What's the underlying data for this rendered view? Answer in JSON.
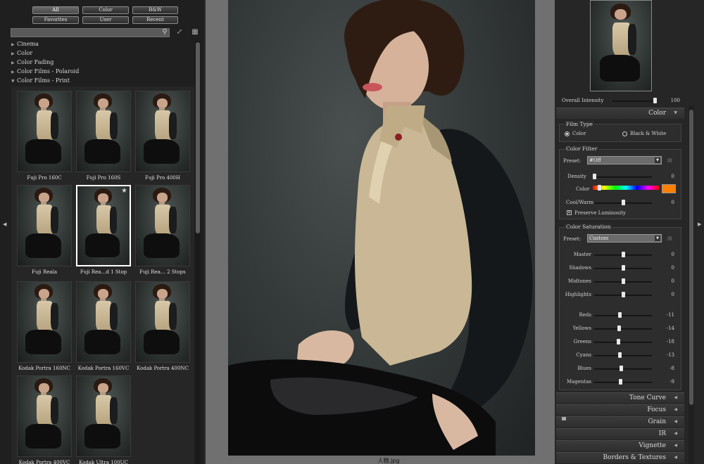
{
  "filter_buttons": [
    {
      "label": "All"
    },
    {
      "label": "Color"
    },
    {
      "label": "B&W"
    },
    {
      "label": "Favorites"
    },
    {
      "label": "User"
    },
    {
      "label": "Recent"
    }
  ],
  "search": {
    "placeholder": ""
  },
  "categories": [
    {
      "label": "Cinema"
    },
    {
      "label": "Color"
    },
    {
      "label": "Color Fading"
    },
    {
      "label": "Color Films - Polaroid"
    },
    {
      "label": "Color Films - Print"
    }
  ],
  "presets": [
    {
      "label": "Fuji Pro 160C"
    },
    {
      "label": "Fuji Pro 160S"
    },
    {
      "label": "Fuji Pro 400H"
    },
    {
      "label": "Fuji Reala"
    },
    {
      "label": "Fuji Rea…d 1 Stop"
    },
    {
      "label": "Fuji Rea… 2 Stops"
    },
    {
      "label": "Kodak Portra 160NC"
    },
    {
      "label": "Kodak Portra 160VC"
    },
    {
      "label": "Kodak Portra 400NC"
    },
    {
      "label": "Kodak Portra 400VC"
    },
    {
      "label": "Kodak Ultra 100UC"
    }
  ],
  "selected_preset_index": 4,
  "favorite_star": "★",
  "filename": "人物.jpg",
  "right": {
    "overall_intensity": {
      "label": "Overall Intensity",
      "value": "100",
      "level": 1.0
    },
    "color_section": {
      "title": "Color"
    },
    "film_type": {
      "title": "Film Type",
      "color_label": "Color",
      "bw_label": "Black & White",
      "selected": "Color"
    },
    "color_filter": {
      "title": "Color Filter",
      "preset_label": "Preset:",
      "preset_value": "#Off",
      "density": {
        "label": "Density",
        "value": "0",
        "level": 0.0
      },
      "color": {
        "label": "Color",
        "swatch": "#ff8000",
        "level": 0.1
      },
      "cool_warm": {
        "label": "Cool/Warm",
        "value": "0",
        "level": 0.5
      },
      "preserve_luminosity": {
        "label": "Preserve Luminosity",
        "checked": true
      }
    },
    "color_saturation": {
      "title": "Color Saturation",
      "preset_label": "Preset:",
      "preset_value": "Custom",
      "sliders": [
        {
          "label": "Master",
          "value": "0",
          "level": 0.5
        },
        {
          "label": "Shadows",
          "value": "0",
          "level": 0.5
        },
        {
          "label": "Midtones",
          "value": "0",
          "level": 0.5
        },
        {
          "label": "Highlights",
          "value": "0",
          "level": 0.5
        }
      ],
      "color_sliders": [
        {
          "label": "Reds",
          "value": "-11",
          "level": 0.445
        },
        {
          "label": "Yellows",
          "value": "-14",
          "level": 0.43
        },
        {
          "label": "Greens",
          "value": "-18",
          "level": 0.41
        },
        {
          "label": "Cyans",
          "value": "-13",
          "level": 0.435
        },
        {
          "label": "Blues",
          "value": "-8",
          "level": 0.46
        },
        {
          "label": "Magentas",
          "value": "-9",
          "level": 0.455
        }
      ]
    },
    "sections": [
      {
        "title": "Tone Curve"
      },
      {
        "title": "Focus"
      },
      {
        "title": "Grain"
      },
      {
        "title": "IR"
      },
      {
        "title": "Vignette"
      },
      {
        "title": "Borders & Textures"
      }
    ]
  },
  "colors": {
    "accent_swatch": "#ff8000",
    "panel_bg": "#1f1f1f",
    "center_bg": "#707070"
  },
  "icons": {
    "search": "search-icon",
    "expand": "expand-icon",
    "grid": "grid-view-icon"
  }
}
